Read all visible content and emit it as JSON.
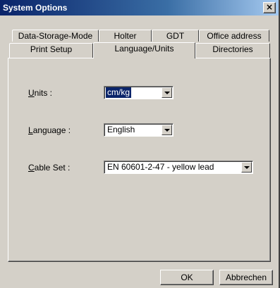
{
  "window": {
    "title": "System Options",
    "close_label": "×"
  },
  "tabs_row1": [
    {
      "label": "Data-Storage-Mode"
    },
    {
      "label": "Holter"
    },
    {
      "label": "GDT"
    },
    {
      "label": "Office address"
    }
  ],
  "tabs_row2": [
    {
      "label": "Print Setup"
    },
    {
      "label": "Language/Units",
      "active": true
    },
    {
      "label": "Directories"
    }
  ],
  "fields": {
    "units": {
      "label_ul": "U",
      "label_rest": "nits :",
      "value": "cm/kg"
    },
    "language": {
      "label_ul": "L",
      "label_rest": "anguage :",
      "value": "English"
    },
    "cable_set": {
      "label_ul": "C",
      "label_rest": "able Set :",
      "value": "EN  60601-2-47 - yellow lead"
    }
  },
  "buttons": {
    "ok": "OK",
    "cancel": "Abbrechen"
  },
  "colors": {
    "title_bar": "#0a246a",
    "face": "#d4d0c8",
    "selection": "#0a246a"
  }
}
